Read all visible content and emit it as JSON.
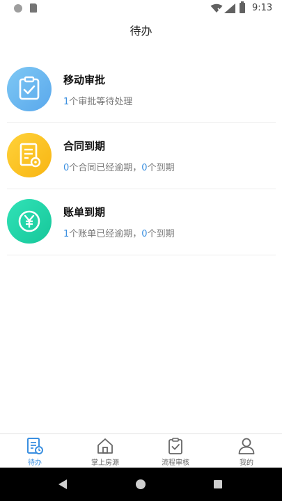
{
  "status_bar": {
    "time": "9:13"
  },
  "header": {
    "title": "待办"
  },
  "items": [
    {
      "title": "移动审批",
      "icon": "approval-clipboard-icon",
      "accent": "#5aa8ec",
      "subtitle": {
        "n1": "1",
        "t1": "个审批等待处理"
      }
    },
    {
      "title": "合同到期",
      "icon": "contract-document-icon",
      "accent": "#f8b512",
      "subtitle": {
        "n1": "0",
        "t1": "个合同已经逾期，",
        "n2": "0",
        "t2": "个到期"
      }
    },
    {
      "title": "账单到期",
      "icon": "yuan-bill-icon",
      "accent": "#16c79a",
      "subtitle": {
        "n1": "1",
        "t1": "个账单已经逾期，",
        "n2": "0",
        "t2": "个到期"
      }
    }
  ],
  "bottom_nav": [
    {
      "label": "待办",
      "icon": "todo-document-icon",
      "active": true
    },
    {
      "label": "掌上房源",
      "icon": "house-icon",
      "active": false
    },
    {
      "label": "流程审核",
      "icon": "clipboard-check-icon",
      "active": false
    },
    {
      "label": "我的",
      "icon": "person-icon",
      "active": false
    }
  ],
  "colors": {
    "accent_blue": "#3a8fe0"
  }
}
